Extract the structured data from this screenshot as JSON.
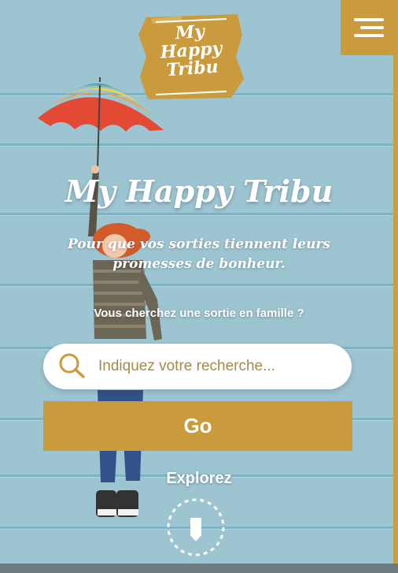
{
  "logo": {
    "line1": "My",
    "line2": "Happy",
    "line3": "Tribu"
  },
  "header": {
    "menu_icon": "hamburger-icon"
  },
  "hero": {
    "title": "My Happy Tribu",
    "tagline": "Pour que vos sorties tiennent leurs promesses de bonheur.",
    "question": "Vous cherchez une sortie en famille ?"
  },
  "search": {
    "placeholder": "Indiquez votre recherche...",
    "value": "",
    "icon": "search-icon"
  },
  "go_button": {
    "label": "Go"
  },
  "explore": {
    "label": "Explorez",
    "icon": "scroll-down-icon"
  },
  "colors": {
    "accent": "#c99b3c",
    "background": "#9cc4d1",
    "placeholder": "#a58a4e"
  }
}
